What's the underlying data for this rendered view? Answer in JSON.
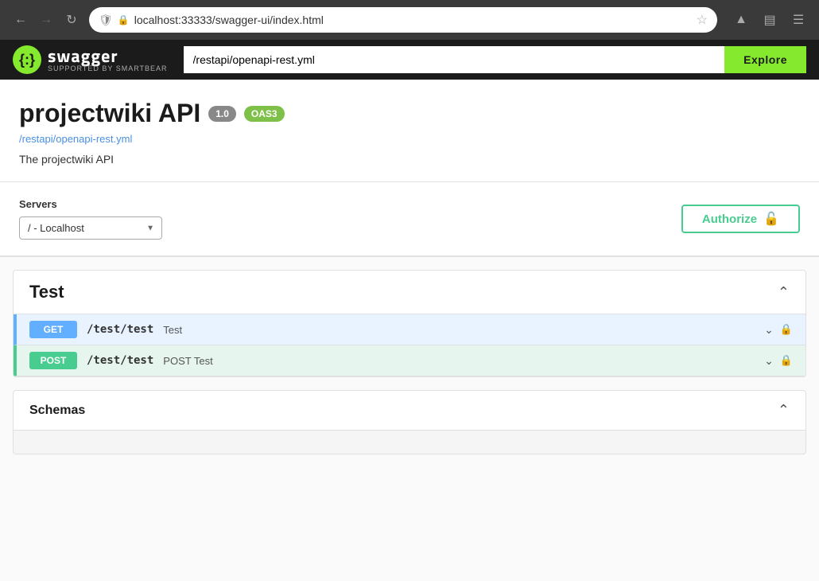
{
  "browser": {
    "url": "localhost:33333/swagger-ui/index.html",
    "back_disabled": false,
    "forward_disabled": true
  },
  "swagger": {
    "logo_symbol": "{:}",
    "logo_title": "swagger",
    "logo_subtitle": "SUPPORTED BY SMARTBEAR",
    "url_input_value": "/restapi/openapi-rest.yml",
    "explore_label": "Explore"
  },
  "api": {
    "title": "projectwiki API",
    "version_badge": "1.0",
    "oas_badge": "OAS3",
    "spec_url": "/restapi/openapi-rest.yml",
    "description": "The projectwiki API"
  },
  "servers": {
    "label": "Servers",
    "selected": "/ - Localhost"
  },
  "authorize": {
    "label": "Authorize",
    "lock_icon": "🔓"
  },
  "sections": {
    "test": {
      "title": "Test",
      "endpoints": [
        {
          "method": "GET",
          "path": "/test/test",
          "summary": "Test"
        },
        {
          "method": "POST",
          "path": "/test/test",
          "summary": "POST Test"
        }
      ]
    },
    "schemas": {
      "title": "Schemas"
    }
  }
}
